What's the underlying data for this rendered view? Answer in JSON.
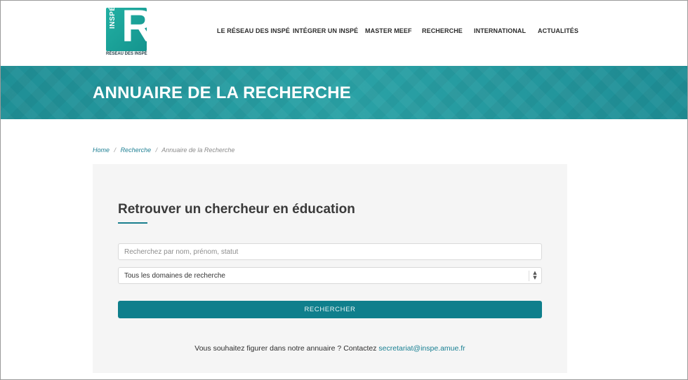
{
  "header": {
    "logo": {
      "letter": "R",
      "vertical_text": "INSPÉ",
      "subtitle": "RÉSEAU DES INSPÉ"
    },
    "nav": [
      {
        "label": "LE RÉSEAU DES INSPÉ"
      },
      {
        "label": "INTÉGRER UN INSPÉ"
      },
      {
        "label": "MASTER MEEF"
      },
      {
        "label": "RECHERCHE"
      },
      {
        "label": "INTERNATIONAL"
      },
      {
        "label": "ACTUALITÉS"
      }
    ]
  },
  "banner": {
    "title": "ANNUAIRE DE LA RECHERCHE"
  },
  "breadcrumb": {
    "home": "Home",
    "separator": "/",
    "parent": "Recherche",
    "current": "Annuaire de la Recherche"
  },
  "search": {
    "title": "Retrouver un chercheur en éducation",
    "input_placeholder": "Recherchez par nom, prénom, statut",
    "input_value": "",
    "domain_selected": "Tous les domaines de recherche",
    "submit_label": "RECHERCHER"
  },
  "contact": {
    "text": "Vous souhaitez figurer dans notre annuaire ? Contactez",
    "email": "secretariat@inspe.amue.fr"
  },
  "colors": {
    "accent": "#0f7f8c",
    "banner": "#2aa2a6",
    "link": "#177f92"
  }
}
